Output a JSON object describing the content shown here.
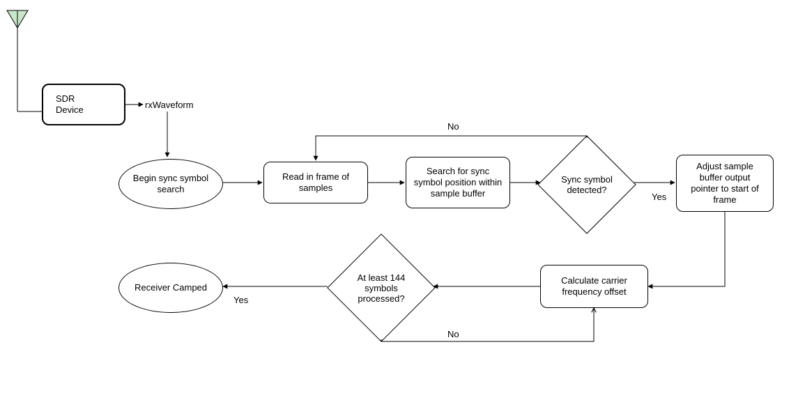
{
  "diagram": {
    "antenna_label": "",
    "sdr_device": "SDR\nDevice",
    "rx_waveform": "rxWaveform",
    "begin_sync": "Begin sync symbol\nsearch",
    "read_frame": "Read in frame of\nsamples",
    "search_sync": "Search for sync\nsymbol position within\nsample buffer",
    "sync_detected": "Sync symbol\ndetected?",
    "adjust_pointer": "Adjust sample\nbuffer output\npointer to start of\nframe",
    "calc_cfo": "Calculate carrier\nfrequency offset",
    "symbols_processed": "At least 144\nsymbols\nprocessed?",
    "receiver_camped": "Receiver Camped",
    "edge_no_top": "No",
    "edge_yes_right": "Yes",
    "edge_no_bottom": "No",
    "edge_yes_left": "Yes"
  }
}
